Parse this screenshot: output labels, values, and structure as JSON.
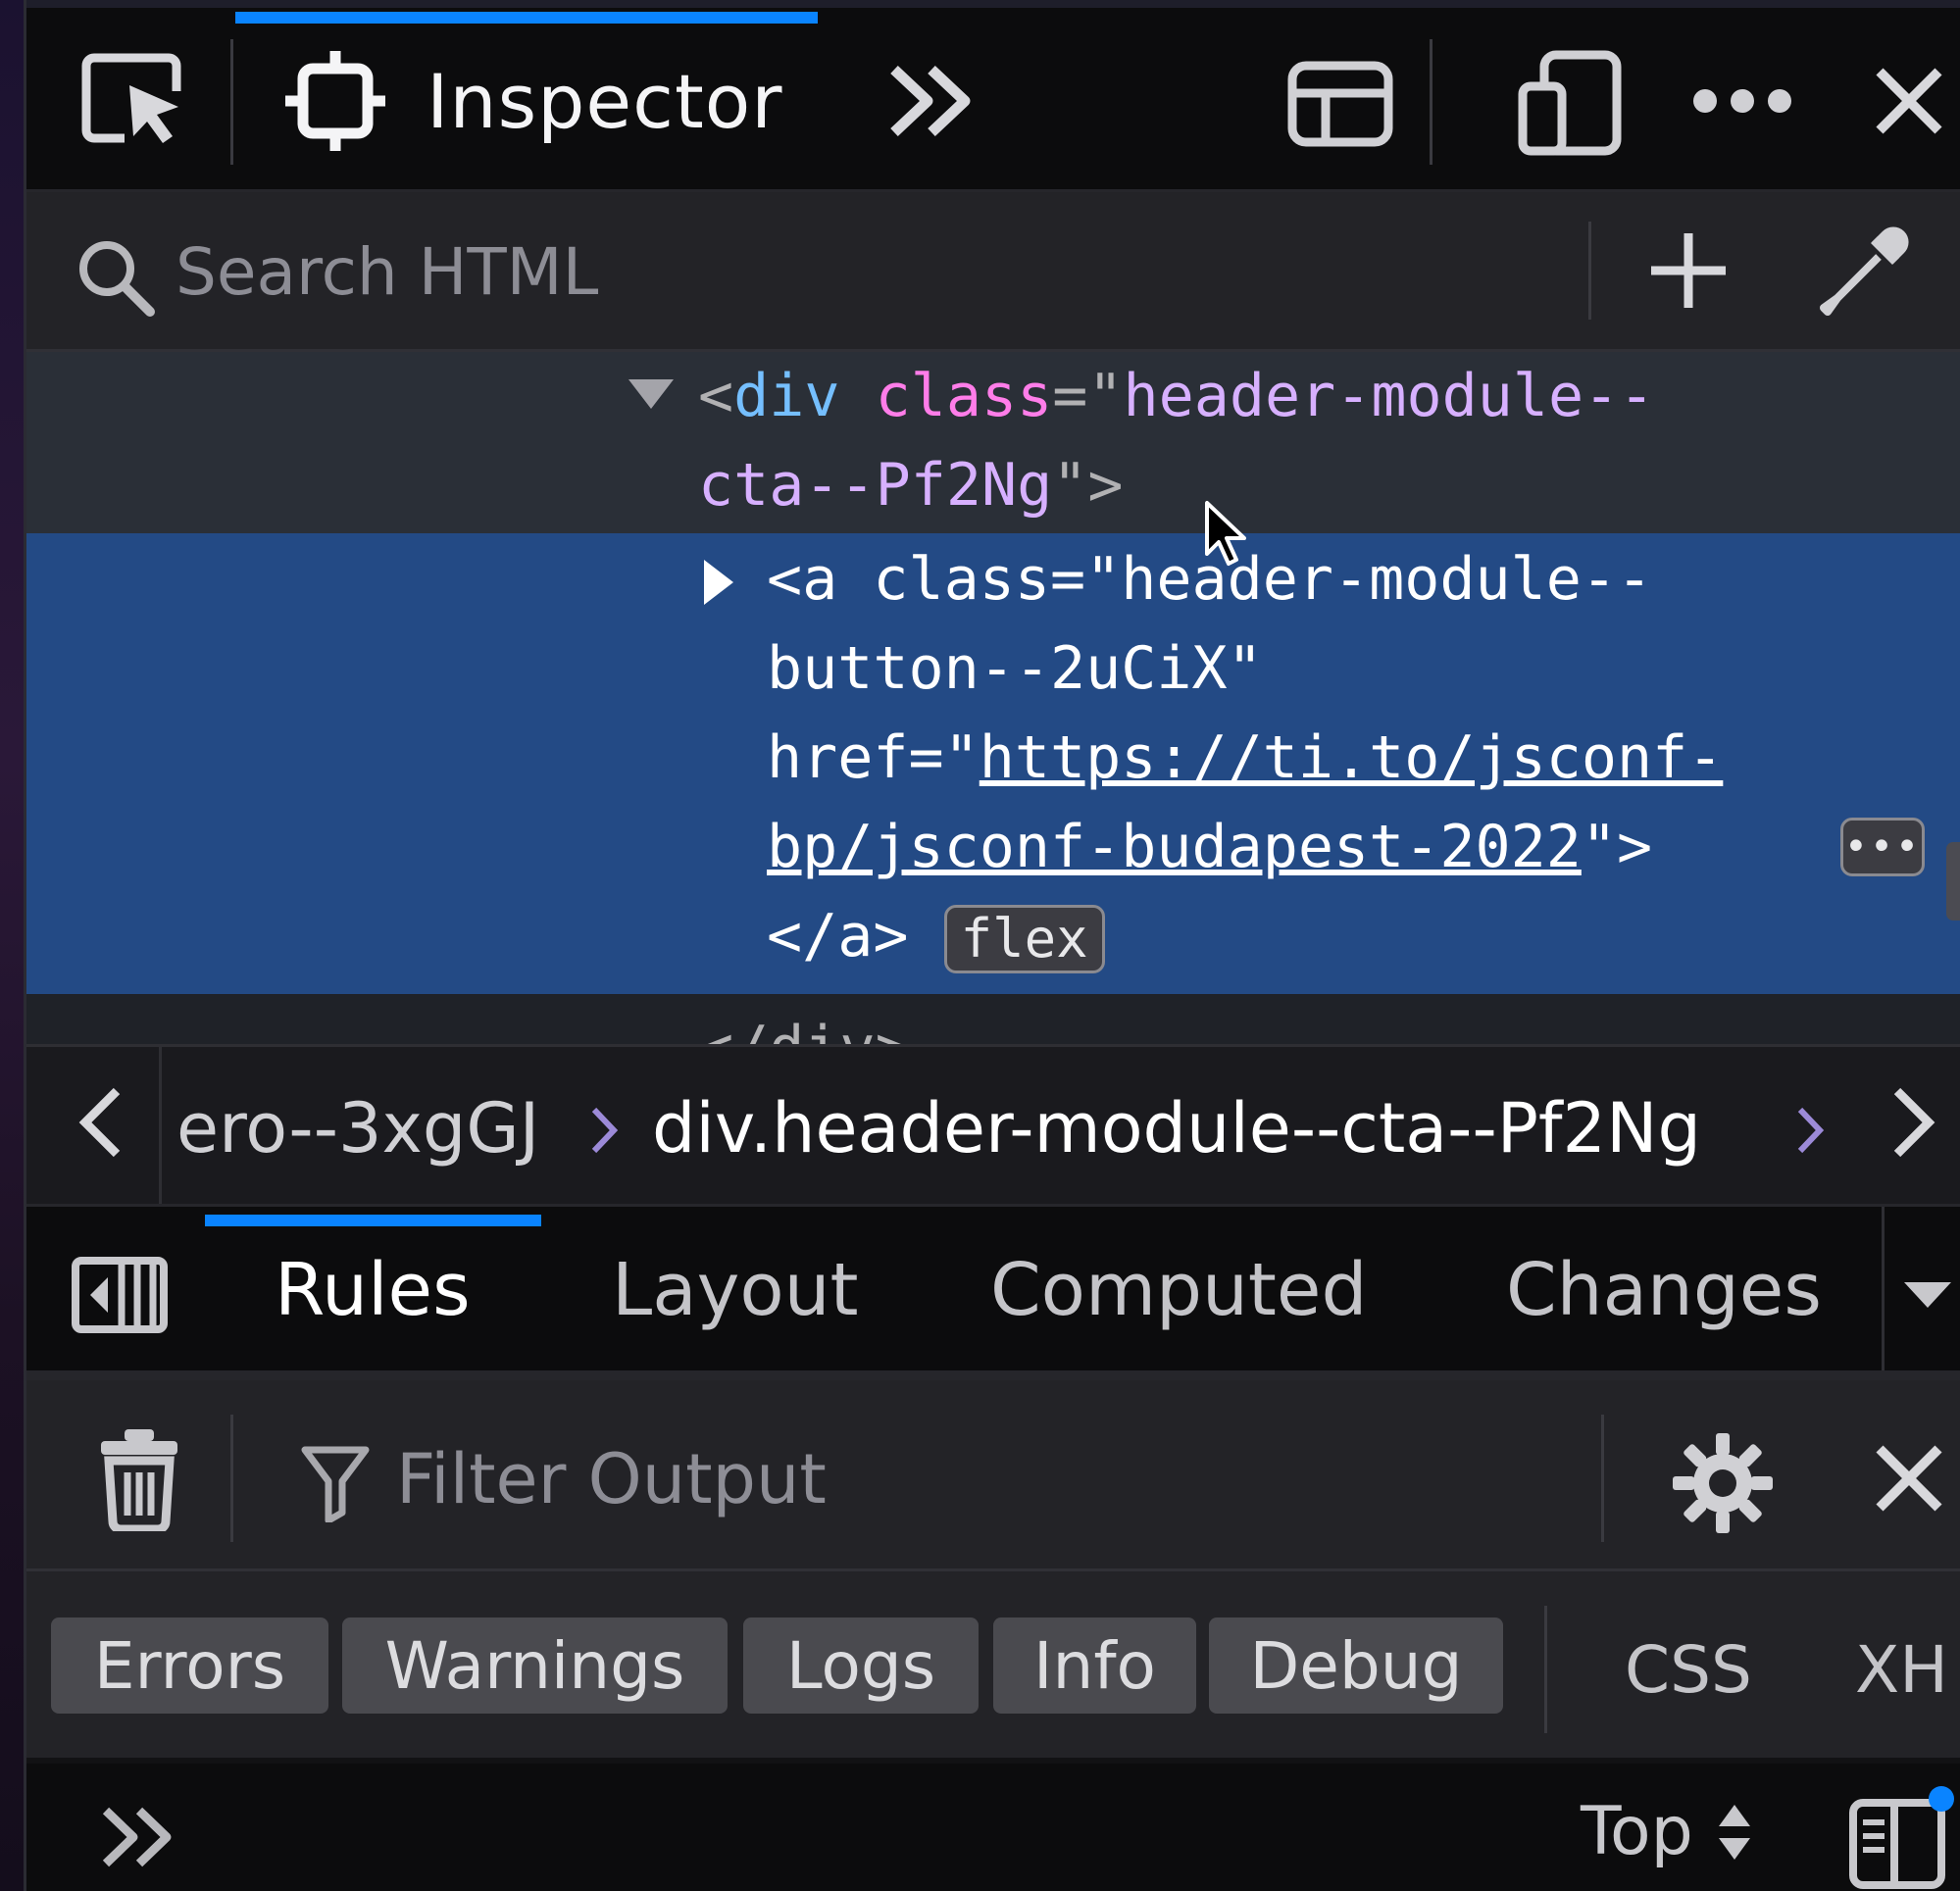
{
  "toolbar": {
    "active_tab_label": "Inspector",
    "icons": [
      "element-picker-icon",
      "inspector-icon",
      "more-tools-chevron-icon",
      "dock-layout-icon",
      "responsive-design-icon",
      "more-options-icon",
      "close-icon"
    ]
  },
  "search": {
    "placeholder": "Search HTML",
    "value": ""
  },
  "markup": {
    "parent_line1_open": "<",
    "parent_tag": "div",
    "parent_attr": "class",
    "parent_eq": "=\"",
    "parent_val_line1": "header-module--",
    "parent_val_line2": "cta--Pf2Ng",
    "parent_close": "\">",
    "child_line1": "<a class=\"header-module--",
    "child_line2": "button--2uCiX\"",
    "child_line3_prefix": "href=\"",
    "child_url_line1": "https://ti.to/jsconf-",
    "child_url_line2": "bp/jsconf-budapest-2022",
    "child_line4_suffix": "\">",
    "ellipsis_badge": "•••",
    "child_close": "</a>",
    "flex_badge": "flex",
    "partial_line": "</div>"
  },
  "breadcrumbs": {
    "previous": "ero--3xgGJ",
    "current": "div.header-module--cta--Pf2Ng"
  },
  "sidebar_tabs": {
    "items": [
      {
        "label": "Rules",
        "active": true
      },
      {
        "label": "Layout",
        "active": false
      },
      {
        "label": "Computed",
        "active": false
      },
      {
        "label": "Changes",
        "active": false
      }
    ]
  },
  "console": {
    "filter_placeholder": "Filter Output",
    "filter_value": "",
    "levels": [
      "Errors",
      "Warnings",
      "Logs",
      "Info",
      "Debug"
    ],
    "categories": [
      "CSS",
      "XH"
    ],
    "context_label": "Top",
    "colors": {
      "accent": "#0a84ff",
      "selected_row": "#234a85"
    }
  }
}
